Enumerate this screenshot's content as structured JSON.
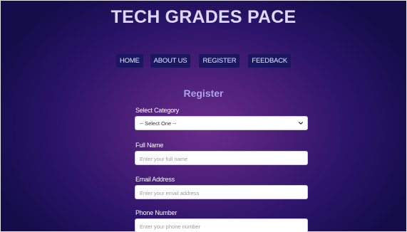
{
  "site": {
    "title": "TECH GRADES PACE"
  },
  "nav": {
    "items": [
      {
        "label": "HOME"
      },
      {
        "label": "ABOUT US"
      },
      {
        "label": "REGISTER"
      },
      {
        "label": "FEEDBACK"
      }
    ]
  },
  "form": {
    "heading": "Register",
    "category": {
      "label": "Select Category",
      "selected": "-- Select One --",
      "icon": "chevron-down-icon"
    },
    "full_name": {
      "label": "Full Name",
      "placeholder": "Enter your full name"
    },
    "email": {
      "label": "Email Address",
      "placeholder": "Enter your email address"
    },
    "phone": {
      "label": "Phone Number",
      "placeholder": "Enter your phone number"
    }
  },
  "colors": {
    "background_center": "#6a2c8a",
    "background_edge": "#140d4a",
    "title_text": "#dcd8f5",
    "nav_button_bg": "#1a1760",
    "heading_text": "#a9a4e6"
  }
}
